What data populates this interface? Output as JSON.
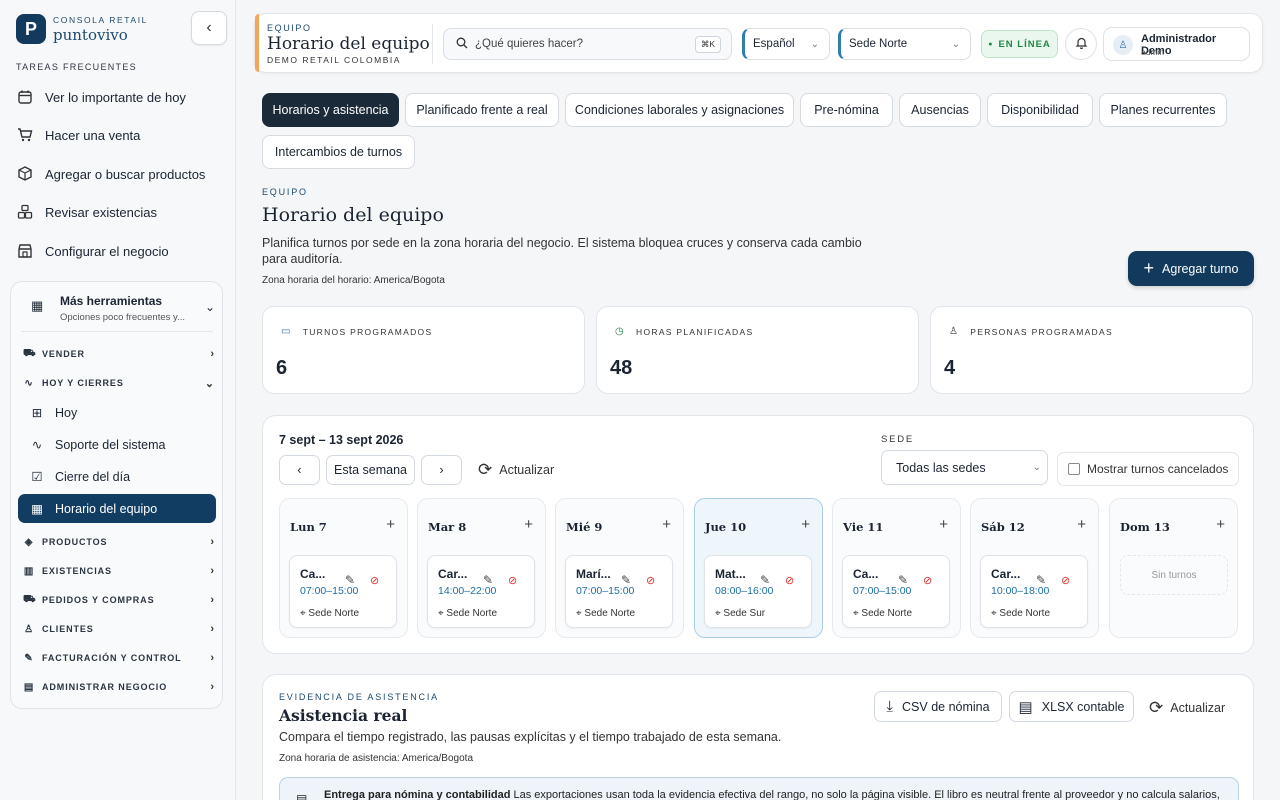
{
  "brand": {
    "label": "CONSOLA RETAIL",
    "name": "puntovivo",
    "logo_letter": "P"
  },
  "sidebar": {
    "frequent_label": "TAREAS FRECUENTES",
    "frequent": [
      "Ver lo importante de hoy",
      "Hacer una venta",
      "Agregar o buscar productos",
      "Revisar existencias",
      "Configurar el negocio"
    ],
    "more_title": "Más herramientas",
    "more_sub": "Opciones poco frecuentes y...",
    "groups": [
      "VENDER",
      "HOY Y CIERRES"
    ],
    "subitems": [
      "Hoy",
      "Soporte del sistema",
      "Cierre del día",
      "Horario del equipo"
    ],
    "groups2": [
      "PRODUCTOS",
      "EXISTENCIAS",
      "PEDIDOS Y COMPRAS",
      "CLIENTES",
      "FACTURACIÓN Y CONTROL",
      "ADMINISTRAR NEGOCIO"
    ]
  },
  "topbar": {
    "eyebrow": "EQUIPO",
    "title": "Horario del equipo",
    "subtitle": "DEMO RETAIL COLOMBIA",
    "search_placeholder": "¿Qué quieres hacer?",
    "shortcut": "⌘K",
    "language": "Español",
    "branch": "Sede Norte",
    "status": "EN LÍNEA",
    "user_name": "Administrador Demo",
    "user_role": "admin"
  },
  "tabs": [
    "Horarios y asistencia",
    "Planificado frente a real",
    "Condiciones laborales y asignaciones",
    "Pre-nómina",
    "Ausencias",
    "Disponibilidad",
    "Planes recurrentes",
    "Intercambios de turnos"
  ],
  "page": {
    "eyebrow": "EQUIPO",
    "title": "Horario del equipo",
    "description": "Planifica turnos por sede en la zona horaria del negocio. El sistema bloquea cruces y conserva cada cambio para auditoría.",
    "timezone": "Zona horaria del horario: America/Bogota",
    "add_button": "Agregar turno"
  },
  "stats": [
    {
      "label": "TURNOS PROGRAMADOS",
      "value": "6"
    },
    {
      "label": "HORAS PLANIFICADAS",
      "value": "48"
    },
    {
      "label": "PERSONAS PROGRAMADAS",
      "value": "4"
    }
  ],
  "schedule": {
    "range": "7 sept – 13 sept 2026",
    "this_week": "Esta semana",
    "refresh": "Actualizar",
    "sede_label": "SEDE",
    "sede_value": "Todas las sedes",
    "show_cancelled": "Mostrar turnos cancelados",
    "days": [
      {
        "label": "Lun 7",
        "shift": {
          "name": "Ca...",
          "time": "07:00–15:00",
          "location": "Sede Norte"
        }
      },
      {
        "label": "Mar 8",
        "shift": {
          "name": "Car...",
          "time": "14:00–22:00",
          "location": "Sede Norte"
        }
      },
      {
        "label": "Mié 9",
        "shift": {
          "name": "Marí...",
          "time": "07:00–15:00",
          "location": "Sede Norte"
        }
      },
      {
        "label": "Jue 10",
        "shift": {
          "name": "Mat...",
          "time": "08:00–16:00",
          "location": "Sede Sur"
        }
      },
      {
        "label": "Vie 11",
        "shift": {
          "name": "Ca...",
          "time": "07:00–15:00",
          "location": "Sede Norte"
        }
      },
      {
        "label": "Sáb 12",
        "shift": {
          "name": "Car...",
          "time": "10:00–18:00",
          "location": "Sede Norte"
        }
      },
      {
        "label": "Dom 13",
        "empty": "Sin turnos"
      }
    ]
  },
  "attendance": {
    "eyebrow": "EVIDENCIA DE ASISTENCIA",
    "title": "Asistencia real",
    "description": "Compara el tiempo registrado, las pausas explícitas y el tiempo trabajado de esta semana.",
    "timezone": "Zona horaria de asistencia: America/Bogota",
    "csv_button": "CSV de nómina",
    "xlsx_button": "XLSX contable",
    "refresh": "Actualizar",
    "note_bold": "Entrega para nómina y contabilidad",
    "note_text": "Las exportaciones usan toda la evidencia efectiva del rango, no solo la página visible. El libro es neutral frente al proveedor y no calcula salarios,"
  }
}
